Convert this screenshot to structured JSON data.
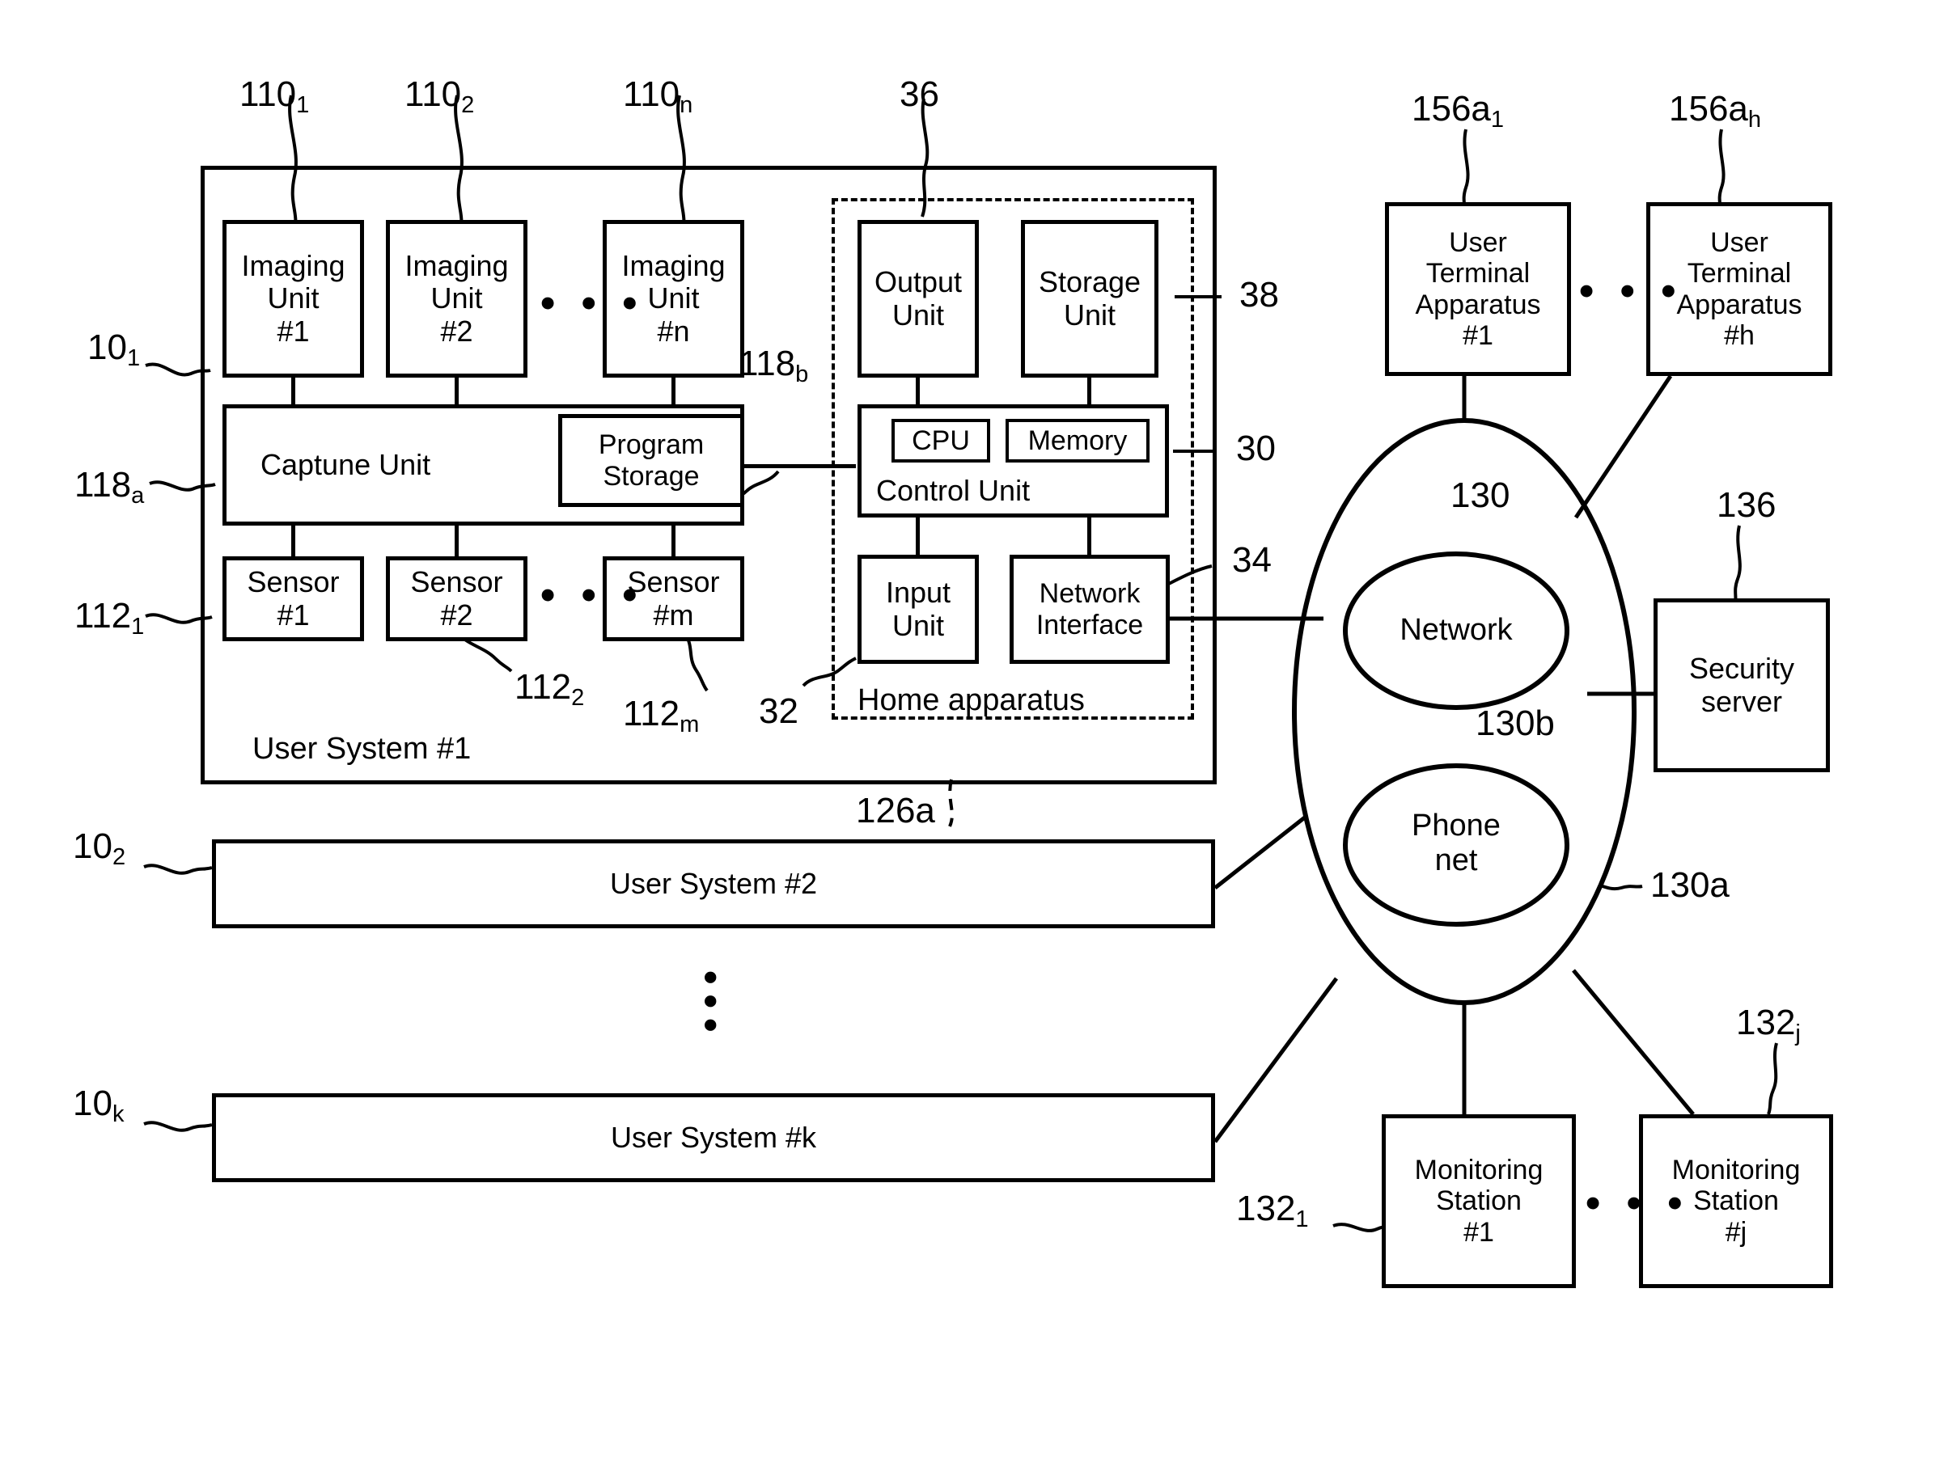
{
  "figure": {
    "kind": "patent-block-diagram",
    "title_visible": false
  },
  "user_system_1": {
    "caption": "User System #1",
    "ref": "10",
    "ref_sub": "1",
    "imaging_units": [
      {
        "line1": "Imaging",
        "line2": "Unit",
        "line3": "#1",
        "ref": "110",
        "ref_sub": "1"
      },
      {
        "line1": "Imaging",
        "line2": "Unit",
        "line3": "#2",
        "ref": "110",
        "ref_sub": "2"
      },
      {
        "line1": "Imaging",
        "line2": "Unit",
        "line3": "#n",
        "ref": "110",
        "ref_sub": "n"
      }
    ],
    "imaging_ellipsis": "• • •",
    "capture_unit": {
      "label": "Captune Unit",
      "ref": "118",
      "ref_sub": "a"
    },
    "program_storage": {
      "line1": "Program",
      "line2": "Storage",
      "ref": "118",
      "ref_sub": "b"
    },
    "sensors": [
      {
        "line1": "Sensor",
        "line2": "#1",
        "ref": "112",
        "ref_sub": "1"
      },
      {
        "line1": "Sensor",
        "line2": "#2",
        "ref": "112",
        "ref_sub": "2"
      },
      {
        "line1": "Sensor",
        "line2": "#m",
        "ref": "112",
        "ref_sub": "m"
      }
    ],
    "sensor_ellipsis": "• • •"
  },
  "home_apparatus": {
    "caption": "Home apparatus",
    "dashed_ref": "126a",
    "output_unit": {
      "line1": "Output",
      "line2": "Unit",
      "ref": "36"
    },
    "storage_unit": {
      "line1": "Storage",
      "line2": "Unit",
      "ref": "38"
    },
    "control_unit": {
      "label": "Control Unit",
      "ref": "30"
    },
    "cpu": {
      "label": "CPU"
    },
    "memory": {
      "label": "Memory"
    },
    "input_unit": {
      "line1": "Input",
      "line2": "Unit",
      "ref": "32"
    },
    "network_interface": {
      "line1": "Network",
      "line2": "Interface",
      "ref": "34"
    }
  },
  "other_user_systems": [
    {
      "label": "User System #2",
      "ref": "10",
      "ref_sub": "2"
    },
    {
      "label": "User System #k",
      "ref": "10",
      "ref_sub": "k"
    }
  ],
  "vertical_ellipsis": "•••",
  "cloud": {
    "ref": "130a",
    "network": {
      "label": "Network",
      "ref": "130"
    },
    "phone_net": {
      "line1": "Phone",
      "line2": "net",
      "ref": "130b"
    }
  },
  "user_terminals": [
    {
      "line1": "User",
      "line2": "Terminal",
      "line3": "Apparatus",
      "line4": "#1",
      "ref": "156a",
      "ref_sub": "1"
    },
    {
      "line1": "User",
      "line2": "Terminal",
      "line3": "Apparatus",
      "line4": "#h",
      "ref": "156a",
      "ref_sub": "h"
    }
  ],
  "user_terminal_ellipsis": "• • •",
  "security_server": {
    "line1": "Security",
    "line2": "server",
    "ref": "136"
  },
  "monitoring_stations": [
    {
      "line1": "Monitoring",
      "line2": "Station",
      "line3": "#1",
      "ref": "132",
      "ref_sub": "1"
    },
    {
      "line1": "Monitoring",
      "line2": "Station",
      "line3": "#j",
      "ref": "132",
      "ref_sub": "j"
    }
  ],
  "monitoring_ellipsis": "• • •",
  "colors": {
    "stroke": "#000000",
    "background": "#ffffff"
  }
}
